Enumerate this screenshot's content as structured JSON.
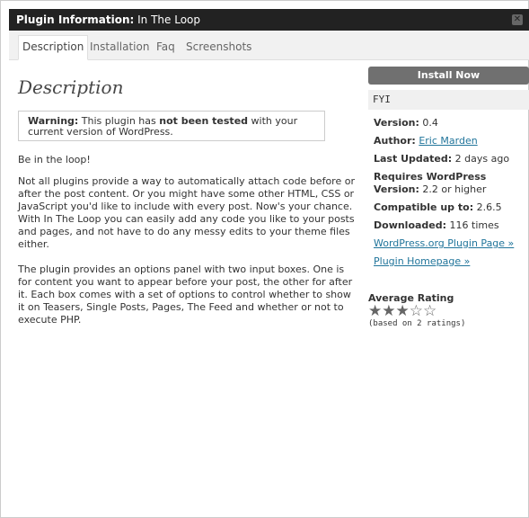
{
  "titlebar": {
    "label": "Plugin Information:",
    "plugin_name": "In The Loop",
    "close": "✕"
  },
  "tabs": [
    {
      "label": "Description"
    },
    {
      "label": "Installation"
    },
    {
      "label": "Faq"
    },
    {
      "label": "Screenshots"
    }
  ],
  "main": {
    "heading": "Description",
    "warning_prefix": "Warning:",
    "warning_mid": " This plugin has ",
    "warning_bold": "not been tested",
    "warning_rest": " with your current version of WordPress.",
    "p1": "Be in the loop!",
    "p2": "Not all plugins provide a way to automatically attach code before or after the post content. Or you might have some other HTML, CSS or JavaScript you'd like to include with every post. Now's your chance. With In The Loop you can easily add any code you like to your posts and pages, and not have to do any messy edits to your theme files either.",
    "p3": "The plugin provides an options panel with two input boxes. One is for content you want to appear before your post, the other for after it. Each box comes with a set of options to control whether to show it on Teasers, Single Posts, Pages, The Feed and whether or not to execute PHP."
  },
  "sidebar": {
    "install_label": "Install Now",
    "fyi": "FYI",
    "version_label": "Version:",
    "version": "0.4",
    "author_label": "Author:",
    "author": "Eric Marden",
    "updated_label": "Last Updated:",
    "updated": "2 days ago",
    "requires_label": "Requires WordPress Version:",
    "requires": "2.2 or higher",
    "compatible_label": "Compatible up to:",
    "compatible": "2.6.5",
    "downloaded_label": "Downloaded:",
    "downloaded": "116 times",
    "link1": "WordPress.org Plugin Page »",
    "link2": "Plugin Homepage »",
    "rating_label": "Average Rating",
    "rating_value": 3,
    "rating_max": 5,
    "rating_sub": "(based on 2 ratings)"
  }
}
